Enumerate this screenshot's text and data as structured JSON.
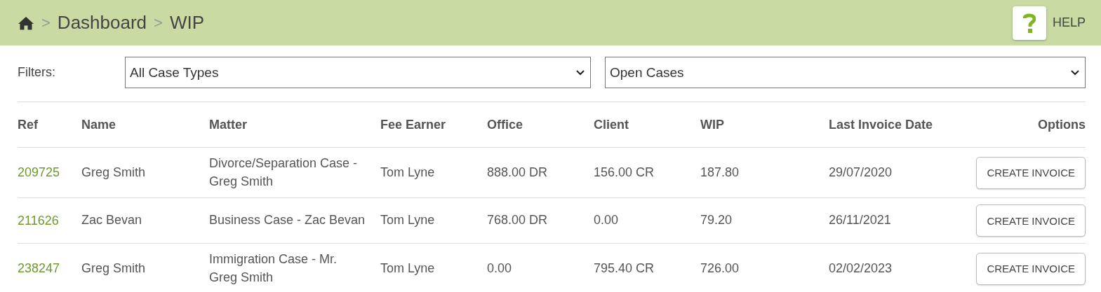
{
  "breadcrumb": [
    {
      "separator": ">",
      "label": "Dashboard"
    },
    {
      "separator": ">",
      "label": "WIP"
    }
  ],
  "help": {
    "label": "HELP"
  },
  "filters": {
    "label": "Filters:",
    "selects": [
      {
        "value": "All Case Types"
      },
      {
        "value": "Open Cases"
      }
    ]
  },
  "table": {
    "columns": [
      "Ref",
      "Name",
      "Matter",
      "Fee Earner",
      "Office",
      "Client",
      "WIP",
      "Last Invoice Date",
      "Options"
    ],
    "rows": [
      {
        "ref": "209725",
        "name": "Greg Smith",
        "matter": [
          "Divorce/Separation Case -",
          "Greg Smith"
        ],
        "fee_earner": "Tom Lyne",
        "office": "888.00 DR",
        "client": "156.00 CR",
        "wip": "187.80",
        "last_invoice_date": "29/07/2020",
        "action": "CREATE INVOICE"
      },
      {
        "ref": "211626",
        "name": "Zac Bevan",
        "matter": [
          "Business Case - Zac Bevan"
        ],
        "fee_earner": "Tom Lyne",
        "office": "768.00 DR",
        "client": "0.00",
        "wip": "79.20",
        "last_invoice_date": "26/11/2021",
        "action": "CREATE INVOICE"
      },
      {
        "ref": "238247",
        "name": "Greg Smith",
        "matter": [
          "Immigration Case - Mr.",
          "Greg Smith"
        ],
        "fee_earner": "Tom Lyne",
        "office": "0.00",
        "client": "795.40 CR",
        "wip": "726.00",
        "last_invoice_date": "02/02/2023",
        "action": "CREATE INVOICE"
      }
    ]
  }
}
